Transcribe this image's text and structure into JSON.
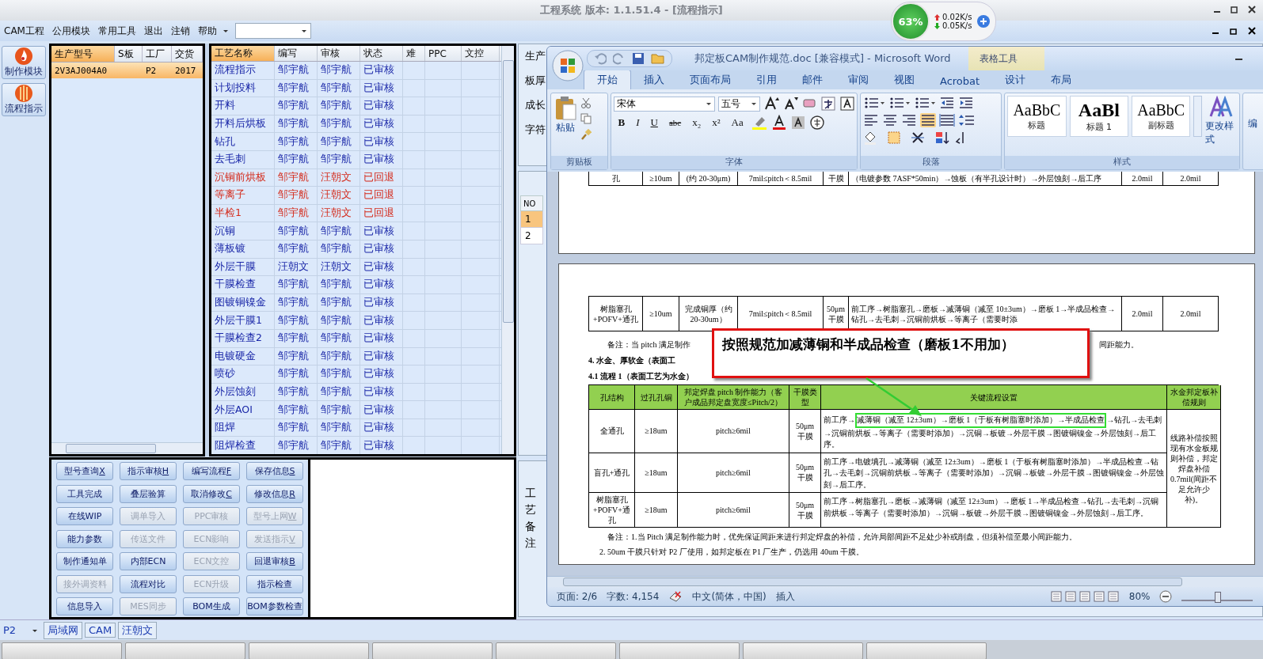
{
  "window": {
    "title": "工程系统   版本: 1.1.51.4 - [流程指示]"
  },
  "net_monitor": {
    "percent": "63%",
    "upload": "0.02K/s",
    "download": "0.05K/s"
  },
  "menu": [
    "CAM工程",
    "公用模块",
    "常用工具",
    "退出",
    "注销",
    "帮助"
  ],
  "sidebar": [
    {
      "label": "制作模块",
      "kind": "flame"
    },
    {
      "label": "流程指示",
      "kind": "ball"
    }
  ],
  "product_table": {
    "columns": [
      "生产型号",
      "S板",
      "工厂",
      "交货"
    ],
    "rows": [
      {
        "model": "2V3AJ004A0",
        "factory": "P2",
        "date": "2017",
        "selected": true
      }
    ]
  },
  "process_table": {
    "columns": [
      "工艺名称",
      "编写",
      "审核",
      "状态",
      "难",
      "PPC",
      "文控"
    ],
    "rows": [
      {
        "name": "流程指示",
        "writer": "邹宇航",
        "reviewer": "邹宇航",
        "status": "已审核",
        "returned": false
      },
      {
        "name": "计划投料",
        "writer": "邹宇航",
        "reviewer": "邹宇航",
        "status": "已审核",
        "returned": false
      },
      {
        "name": "开料",
        "writer": "邹宇航",
        "reviewer": "邹宇航",
        "status": "已审核",
        "returned": false
      },
      {
        "name": "开料后烘板",
        "writer": "邹宇航",
        "reviewer": "邹宇航",
        "status": "已审核",
        "returned": false
      },
      {
        "name": "钻孔",
        "writer": "邹宇航",
        "reviewer": "邹宇航",
        "status": "已审核",
        "returned": false
      },
      {
        "name": "去毛刺",
        "writer": "邹宇航",
        "reviewer": "邹宇航",
        "status": "已审核",
        "returned": false
      },
      {
        "name": "沉铜前烘板",
        "writer": "邹宇航",
        "reviewer": "汪朝文",
        "status": "已回退",
        "returned": true
      },
      {
        "name": "等离子",
        "writer": "邹宇航",
        "reviewer": "汪朝文",
        "status": "已回退",
        "returned": true
      },
      {
        "name": "半检1",
        "writer": "邹宇航",
        "reviewer": "汪朝文",
        "status": "已回退",
        "returned": true
      },
      {
        "name": "沉铜",
        "writer": "邹宇航",
        "reviewer": "邹宇航",
        "status": "已审核",
        "returned": false
      },
      {
        "name": "薄板镀",
        "writer": "邹宇航",
        "reviewer": "邹宇航",
        "status": "已审核",
        "returned": false
      },
      {
        "name": "外层干膜",
        "writer": "汪朝文",
        "reviewer": "汪朝文",
        "status": "已审核",
        "returned": false
      },
      {
        "name": "干膜检查",
        "writer": "邹宇航",
        "reviewer": "邹宇航",
        "status": "已审核",
        "returned": false
      },
      {
        "name": "图镀铜镍金",
        "writer": "邹宇航",
        "reviewer": "邹宇航",
        "status": "已审核",
        "returned": false
      },
      {
        "name": "外层干膜1",
        "writer": "邹宇航",
        "reviewer": "邹宇航",
        "status": "已审核",
        "returned": false
      },
      {
        "name": "干膜检查2",
        "writer": "邹宇航",
        "reviewer": "邹宇航",
        "status": "已审核",
        "returned": false
      },
      {
        "name": "电镀硬金",
        "writer": "邹宇航",
        "reviewer": "邹宇航",
        "status": "已审核",
        "returned": false
      },
      {
        "name": "喷砂",
        "writer": "邹宇航",
        "reviewer": "邹宇航",
        "status": "已审核",
        "returned": false
      },
      {
        "name": "外层蚀刻",
        "writer": "邹宇航",
        "reviewer": "邹宇航",
        "status": "已审核",
        "returned": false
      },
      {
        "name": "外层AOI",
        "writer": "邹宇航",
        "reviewer": "邹宇航",
        "status": "已审核",
        "returned": false
      },
      {
        "name": "阻焊",
        "writer": "邹宇航",
        "reviewer": "邹宇航",
        "status": "已审核",
        "returned": false
      },
      {
        "name": "阻焊检查",
        "writer": "邹宇航",
        "reviewer": "邹宇航",
        "status": "已审核",
        "returned": false
      }
    ]
  },
  "buttons": [
    {
      "label": "型号查询",
      "hotkey": "X",
      "disabled": false
    },
    {
      "label": "指示审核",
      "hotkey": "H",
      "disabled": false
    },
    {
      "label": "编写流程",
      "hotkey": "F",
      "disabled": false
    },
    {
      "label": "保存信息",
      "hotkey": "S",
      "disabled": false
    },
    {
      "label": "工具完成",
      "disabled": false
    },
    {
      "label": "叠层验算",
      "disabled": false
    },
    {
      "label": "取消修改",
      "hotkey": "C",
      "disabled": false
    },
    {
      "label": "修改信息",
      "hotkey": "R",
      "disabled": false
    },
    {
      "label": "在线WIP",
      "disabled": false
    },
    {
      "label": "调单导入",
      "disabled": true
    },
    {
      "label": "PPC审核",
      "disabled": true
    },
    {
      "label": "型号上网",
      "hotkey": "W",
      "disabled": true
    },
    {
      "label": "能力参数",
      "disabled": false
    },
    {
      "label": "传送文件",
      "disabled": true
    },
    {
      "label": "ECN影响",
      "disabled": true
    },
    {
      "label": "发送指示",
      "hotkey": "V",
      "disabled": true
    },
    {
      "label": "制作通知单",
      "disabled": false
    },
    {
      "label": "内部ECN",
      "disabled": false
    },
    {
      "label": "ECN文控",
      "disabled": true
    },
    {
      "label": "回退审核",
      "hotkey": "B",
      "disabled": false
    },
    {
      "label": "接外调资料",
      "disabled": true
    },
    {
      "label": "流程对比",
      "disabled": false
    },
    {
      "label": "ECN升级",
      "disabled": true
    },
    {
      "label": "指示检查",
      "disabled": false
    },
    {
      "label": "信息导入",
      "disabled": false
    },
    {
      "label": "MES同步",
      "disabled": true
    },
    {
      "label": "BOM生成",
      "disabled": false
    },
    {
      "label": "BOM参数检查",
      "disabled": false
    }
  ],
  "right_panel": {
    "labels": [
      "生产",
      "板厚",
      "成长",
      "字符"
    ],
    "no_table": {
      "header": "NO",
      "rows": [
        {
          "no": "1",
          "selected": true
        },
        {
          "no": "2",
          "selected": false
        }
      ]
    },
    "remark_label": "工艺备注"
  },
  "word": {
    "title": "邦定板CAM制作规范.doc [兼容模式] - Microsoft Word",
    "context_tab": "表格工具",
    "tabs": [
      {
        "label": "开始",
        "selected": true
      },
      {
        "label": "插入",
        "selected": false
      },
      {
        "label": "页面布局",
        "selected": false
      },
      {
        "label": "引用",
        "selected": false
      },
      {
        "label": "邮件",
        "selected": false
      },
      {
        "label": "审阅",
        "selected": false
      },
      {
        "label": "视图",
        "selected": false
      },
      {
        "label": "Acrobat",
        "selected": false
      },
      {
        "label": "设计",
        "selected": false
      },
      {
        "label": "布局",
        "selected": false
      }
    ],
    "paste": "粘贴",
    "font": "宋体",
    "size": "五号",
    "format_buttons": [
      "B",
      "I",
      "U",
      "abc",
      "x₂",
      "x²",
      "Aa"
    ],
    "groups": [
      "剪贴板",
      "字体",
      "段落",
      "样式"
    ],
    "styles": [
      {
        "sample": "AaBbC",
        "name": "标题"
      },
      {
        "sample": "AaBl",
        "name": "标题 1"
      },
      {
        "sample": "AaBbC",
        "name": "副标题"
      }
    ],
    "change_styles": "更改样式",
    "edit_group": "编",
    "status": {
      "page": "页面: 2/6",
      "words": "字数: 4,154",
      "language": "中文(简体，中国)",
      "mode": "插入",
      "zoom": "80%",
      "zoom_slider": {
        "level": 0.5
      }
    }
  },
  "document": {
    "page1_row": [
      "孔",
      "≥10um",
      "(约 20-30μm)",
      "7mil≤pitch＜8.5mil",
      "干膜",
      "（电镀参数 7ASF*50min）→蚀板（有半孔设计时）→外层蚀刻→后工序",
      "2.0mil",
      "2.0mil"
    ],
    "page2_row": [
      "树脂塞孔+POFV+通孔",
      "≥10um",
      "完成铜厚（约 20-30um）",
      "7mil≤pitch＜8.5mil",
      "50μm干膜",
      "前工序→树脂塞孔→磨板→减薄铜（减至 10±3um）→磨板 1→半成品检查→钻孔→去毛刺→沉铜前烘板→等离子（需要时添",
      "2.0mil",
      "2.0mil"
    ],
    "note_left": "备注：当 pitch 满足制作",
    "note_right": "间距能力。",
    "heading": "4. 水金、厚软金（表面工",
    "subheading": "4.1   流程 1（表面工艺为水金）",
    "table": {
      "columns": [
        "孔结构",
        "过孔孔铜",
        "邦定焊盘 pitch 制作能力（客户成品邦定盘宽度≤Pitch/2）",
        "干膜类型",
        "关键流程设置",
        "水金邦定板补偿规则"
      ],
      "rows": [
        {
          "structure": "全通孔",
          "copper": "≥18um",
          "pitch": "pitch≥6mil",
          "film": "50μm 干膜",
          "flow": [
            {
              "text": "前工序→",
              "highlight": false
            },
            {
              "text": "减薄铜（减至 12±3um）→磨板 1（于板有树脂塞时添加）→半成品检查",
              "highlight": true
            },
            {
              "text": "→钻孔→去毛刺→沉铜前烘板→等离子（需要时添加）→沉铜→板镀→外层干膜→图镀铜镍金→外层蚀刻→后工序。",
              "highlight": false
            }
          ]
        },
        {
          "structure": "盲孔+通孔",
          "copper": "≥18um",
          "pitch": "pitch≥6mil",
          "film": "50μm 干膜",
          "flow": [
            {
              "text": "前工序→电镀填孔→减薄铜（减至 12±3um）→磨板 1（于板有树脂塞时添加）→半成品检查→钻孔→去毛刺→沉铜前烘板→等离子（需要时添加）→沉铜→板镀→外层干膜→图镀铜镍金→外层蚀刻→后工序。",
              "highlight": false
            }
          ]
        },
        {
          "structure": "树脂塞孔+POFV+通孔",
          "copper": "≥18um",
          "pitch": "pitch≥6mil",
          "film": "50μm 干膜",
          "flow": [
            {
              "text": "前工序→树脂塞孔→磨板→减薄铜（减至 12±3um）→磨板 1→半成品检查→钻孔→去毛刺→沉铜前烘板→等离子（需要时添加）→沉铜→板镀→外层干膜→图镀铜镍金→外层蚀刻→后工序。",
              "highlight": false
            }
          ]
        }
      ],
      "rule": "线路补偿按照现有水金板规则补偿，邦定焊盘补偿 0.7mil(间距不足允许少补)。"
    },
    "notes": [
      "备注：1.当 Pitch 满足制作能力时，优先保证间距来进行邦定焊盘的补偿，允许局部间距不足处少补或削盘，但须补偿至最小间距能力。",
      "2. 50um 干膜只针对 P2 厂使用，如邦定板在 P1 厂生产，仍选用 40um 干膜。"
    ],
    "callout": "按照规范加减薄铜和半成品检查（磨板1不用加）"
  },
  "status_bar": {
    "factory": "P2",
    "items": [
      "局域网",
      "CAM",
      "汪朝文"
    ]
  }
}
